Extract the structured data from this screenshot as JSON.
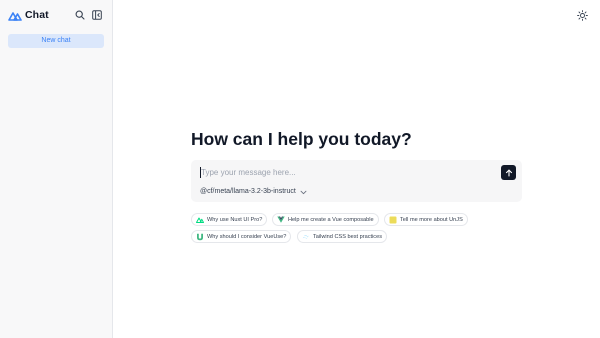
{
  "sidebar": {
    "brand": "Chat",
    "new_chat_label": "New chat",
    "icons": [
      "logo-icon",
      "search-icon",
      "sidebar-toggle-icon"
    ]
  },
  "header": {
    "theme_icon": "sun-icon"
  },
  "main": {
    "headline": "How can I help you today?",
    "input_placeholder": "Type your message here...",
    "model": "@cf/meta/llama-3.2-3b-instruct",
    "send_icon": "arrow-up-icon",
    "suggestions": [
      {
        "label": "Why use Nuxt UI Pro?",
        "icon": "nuxt-icon",
        "color": "#00dc82"
      },
      {
        "label": "Help me create a Vue composable",
        "icon": "vue-icon",
        "color": "#41b883"
      },
      {
        "label": "Tell me more about UnJS",
        "icon": "unjs-icon",
        "color": "#ecdc5a"
      },
      {
        "label": "Why should I consider VueUse?",
        "icon": "vueuse-icon",
        "color": "#41b883"
      },
      {
        "label": "Tailwind CSS best practices",
        "icon": "tailwind-icon",
        "color": "#38bdf8"
      }
    ]
  },
  "colors": {
    "accent": "#3b82f6",
    "new_chat_bg": "#dbe7fb",
    "sidebar_bg": "#f8f8f9",
    "composer_bg": "#f6f6f7",
    "send_bg": "#111827"
  }
}
